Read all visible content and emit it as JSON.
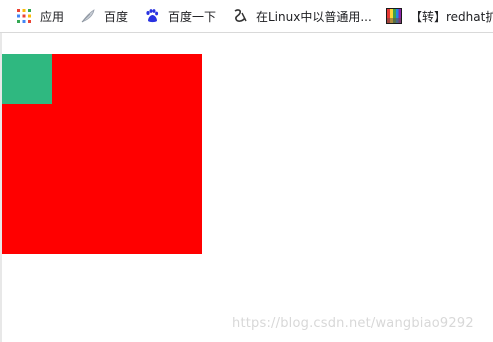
{
  "bookmarks": {
    "apps_label": "应用",
    "baidu_label": "百度",
    "baidu_search_label": "百度一下",
    "linux_label": "在Linux中以普通用...",
    "redhat_label": "【转】redhat扩"
  },
  "colors": {
    "red_box": "#ff0000",
    "green_box": "#2fb880"
  },
  "watermark": "https://blog.csdn.net/wangbiao9292"
}
